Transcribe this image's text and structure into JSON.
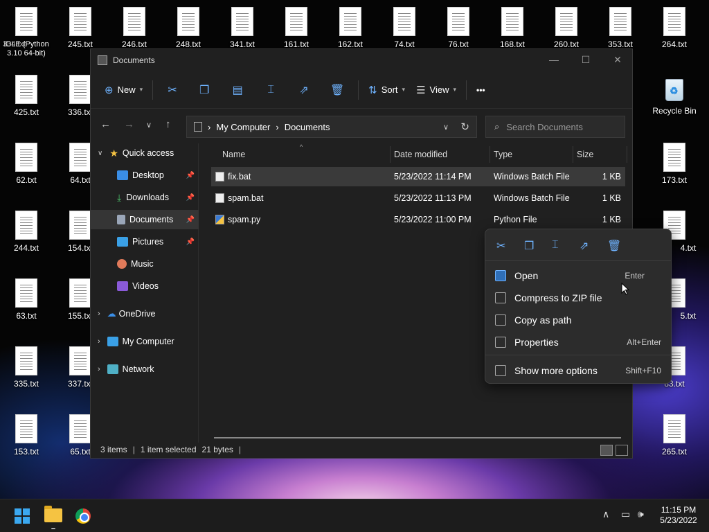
{
  "desktop": {
    "icons": [
      {
        "label": "IDLE (Python 3.10 64-bit)"
      },
      {
        "label": "245.txt"
      },
      {
        "label": "246.txt"
      },
      {
        "label": "248.txt"
      },
      {
        "label": "341.txt"
      },
      {
        "label": "161.txt"
      },
      {
        "label": "162.txt"
      },
      {
        "label": "74.txt"
      },
      {
        "label": "76.txt"
      },
      {
        "label": "168.txt"
      },
      {
        "label": "260.txt"
      },
      {
        "label": "353.txt"
      },
      {
        "label": "264.txt"
      },
      {
        "label": "425.txt"
      },
      {
        "label": "336.txt"
      },
      {
        "label": "Recycle Bin"
      },
      {
        "label": "62.txt"
      },
      {
        "label": "64.txt"
      },
      {
        "label": "173.txt"
      },
      {
        "label": "244.txt"
      },
      {
        "label": "154.txt"
      },
      {
        "label": "4.txt"
      },
      {
        "label": "63.txt"
      },
      {
        "label": "155.txt"
      },
      {
        "label": "5.txt"
      },
      {
        "label": "335.txt"
      },
      {
        "label": "337.txt"
      },
      {
        "label": "83.txt"
      },
      {
        "label": "153.txt"
      },
      {
        "label": "65.txt"
      },
      {
        "label": "265.txt"
      }
    ],
    "top_left_overlap": "334.txt"
  },
  "window": {
    "title": "Documents",
    "controls": {
      "minimize": "—",
      "maximize": "☐",
      "close": "✕"
    },
    "toolbar": {
      "new_label": "New",
      "sort_label": "Sort",
      "view_label": "View",
      "more_label": "•••"
    },
    "address": {
      "segments": [
        "My Computer",
        "Documents"
      ]
    },
    "search": {
      "placeholder": "Search Documents"
    },
    "sidebar": {
      "items": [
        {
          "label": "Quick access"
        },
        {
          "label": "Desktop"
        },
        {
          "label": "Downloads"
        },
        {
          "label": "Documents"
        },
        {
          "label": "Pictures"
        },
        {
          "label": "Music"
        },
        {
          "label": "Videos"
        },
        {
          "label": "OneDrive"
        },
        {
          "label": "My Computer"
        },
        {
          "label": "Network"
        }
      ]
    },
    "columns": {
      "name": "Name",
      "date": "Date modified",
      "type": "Type",
      "size": "Size"
    },
    "files": [
      {
        "name": "fix.bat",
        "date": "5/23/2022 11:14 PM",
        "type": "Windows Batch File",
        "size": "1 KB",
        "selected": true
      },
      {
        "name": "spam.bat",
        "date": "5/23/2022 11:13 PM",
        "type": "Windows Batch File",
        "size": "1 KB",
        "selected": false
      },
      {
        "name": "spam.py",
        "date": "5/23/2022 11:00 PM",
        "type": "Python File",
        "size": "1 KB",
        "selected": false
      }
    ],
    "status": {
      "items": "3 items",
      "selected": "1 item selected",
      "bytes": "21 bytes"
    }
  },
  "context_menu": {
    "top_icons": [
      "cut-icon",
      "copy-icon",
      "rename-icon",
      "share-icon",
      "delete-icon"
    ],
    "items": [
      {
        "label": "Open",
        "shortcut": "Enter"
      },
      {
        "label": "Compress to ZIP file",
        "shortcut": ""
      },
      {
        "label": "Copy as path",
        "shortcut": ""
      },
      {
        "label": "Properties",
        "shortcut": "Alt+Enter"
      },
      {
        "label": "Show more options",
        "shortcut": "Shift+F10"
      }
    ]
  },
  "taskbar": {
    "time": "11:15 PM",
    "date": "5/23/2022"
  },
  "colors": {
    "accent": "#6fb3ff",
    "window_bg": "#202020",
    "menu_bg": "#2c2c2c"
  }
}
